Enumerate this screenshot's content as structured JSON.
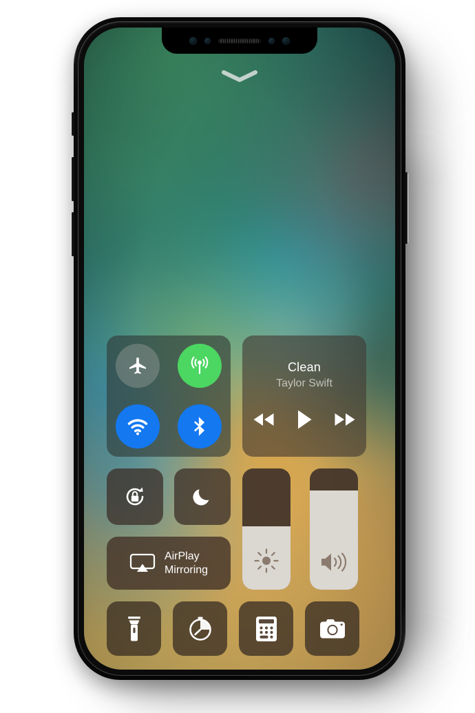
{
  "device": {
    "name": "iPhone X",
    "notch": {
      "sensors": [
        "infrared-camera-icon",
        "flood-illuminator-icon",
        "earpiece-speaker-grill",
        "proximity-sensor-icon",
        "front-camera-icon"
      ]
    },
    "side_buttons": [
      {
        "name": "mute-switch",
        "side": "left"
      },
      {
        "name": "volume-up-button",
        "side": "left"
      },
      {
        "name": "volume-down-button",
        "side": "left"
      },
      {
        "name": "power-button",
        "side": "right"
      }
    ]
  },
  "screen": {
    "panel_title": "Control Center",
    "handle_icon": "chevron-down-icon",
    "wallpaper_colors": {
      "top": "#133029",
      "mid": "#2f7670",
      "bottom": "#d6ad63"
    }
  },
  "connectivity": {
    "toggles": [
      {
        "name": "airplane-mode-toggle",
        "label": "Airplane Mode",
        "icon": "airplane-icon",
        "state": "off",
        "color": "#7e8c86"
      },
      {
        "name": "cellular-data-toggle",
        "label": "Cellular Data",
        "icon": "cellular-antenna-icon",
        "state": "on",
        "color": "#4cd662"
      },
      {
        "name": "wifi-toggle",
        "label": "Wi-Fi",
        "icon": "wifi-icon",
        "state": "on",
        "color": "#1478f0"
      },
      {
        "name": "bluetooth-toggle",
        "label": "Bluetooth",
        "icon": "bluetooth-icon",
        "state": "on",
        "color": "#1478f0"
      }
    ]
  },
  "media": {
    "title": "Clean",
    "artist": "Taylor Swift",
    "controls": [
      {
        "name": "rewind-button",
        "label": "Rewind",
        "icon": "rewind-icon"
      },
      {
        "name": "play-button",
        "label": "Play",
        "icon": "play-icon"
      },
      {
        "name": "fast-forward-button",
        "label": "Fast Forward",
        "icon": "fast-forward-icon"
      }
    ]
  },
  "quick_toggles": [
    {
      "name": "rotation-lock-button",
      "label": "Portrait Orientation Lock",
      "icon": "rotation-lock-icon"
    },
    {
      "name": "do-not-disturb-button",
      "label": "Do Not Disturb",
      "icon": "moon-icon"
    }
  ],
  "airplay": {
    "label_line1": "AirPlay",
    "label_line2": "Mirroring",
    "icon": "airplay-icon"
  },
  "sliders": [
    {
      "name": "brightness-slider",
      "label": "Brightness",
      "icon": "brightness-sun-icon",
      "value": 52
    },
    {
      "name": "volume-slider",
      "label": "Volume",
      "icon": "volume-icon",
      "value": 82
    }
  ],
  "utilities": [
    {
      "name": "flashlight-button",
      "label": "Flashlight",
      "icon": "flashlight-icon"
    },
    {
      "name": "timer-button",
      "label": "Timer",
      "icon": "timer-icon"
    },
    {
      "name": "calculator-button",
      "label": "Calculator",
      "icon": "calculator-icon"
    },
    {
      "name": "camera-button",
      "label": "Camera",
      "icon": "camera-icon"
    }
  ]
}
